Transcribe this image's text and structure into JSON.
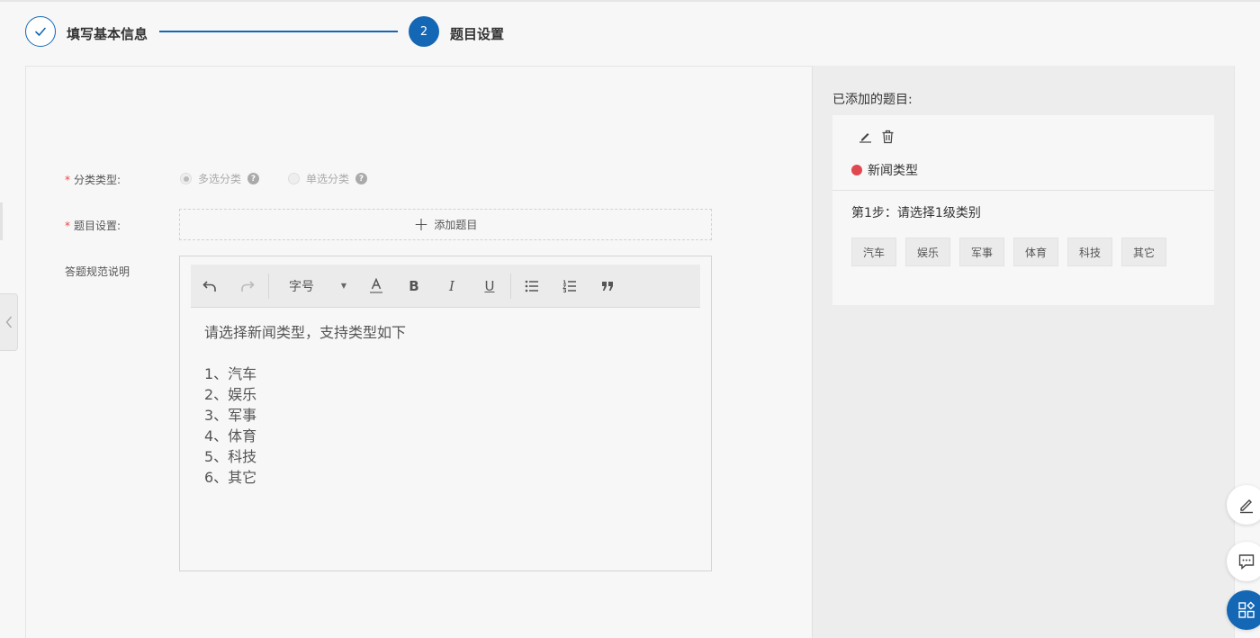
{
  "steps": {
    "step1_label": "填写基本信息",
    "step2_number": "2",
    "step2_label": "题目设置"
  },
  "form": {
    "category_label": "分类类型:",
    "required_mark": "*",
    "radio_multi": "多选分类",
    "radio_single": "单选分类",
    "question_label": "题目设置:",
    "add_question": "添加题目",
    "spec_label": "答题规范说明"
  },
  "editor": {
    "font_size_label": "字号",
    "intro": "请选择新闻类型，支持类型如下",
    "lines": [
      "1、汽车",
      "2、娱乐",
      "3、军事",
      "4、体育",
      "5、科技",
      "6、其它"
    ]
  },
  "right_panel": {
    "title": "已添加的题目:",
    "type_label": "新闻类型",
    "step_text": "第1步：请选择1级类别",
    "tags": [
      "汽车",
      "娱乐",
      "军事",
      "体育",
      "科技",
      "其它"
    ]
  },
  "colors": {
    "accent": "#1467b5",
    "required": "#ee4444",
    "type_dot": "#e0484f"
  }
}
